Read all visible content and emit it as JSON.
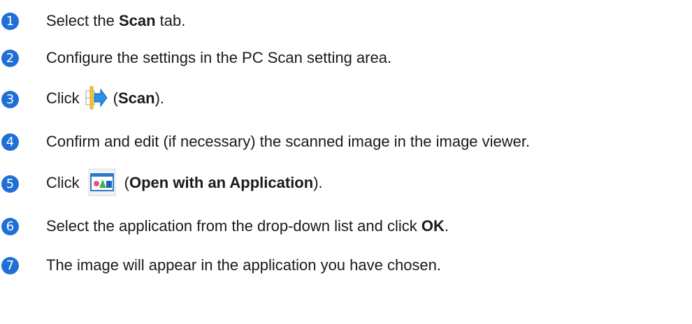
{
  "steps": [
    {
      "num": "1",
      "pre": "Select the ",
      "bold": "Scan",
      "post": " tab."
    },
    {
      "num": "2",
      "text": "Configure the settings in the PC Scan setting area."
    },
    {
      "num": "3",
      "pre": "Click",
      "icon": "scan-icon",
      "paren_open": "(",
      "bold": "Scan",
      "paren_close": ")."
    },
    {
      "num": "4",
      "text": "Confirm and edit (if necessary) the scanned image in the image viewer."
    },
    {
      "num": "5",
      "pre": "Click",
      "icon": "open-with-application-icon",
      "paren_open": "(",
      "bold": "Open with an Application",
      "paren_close": ")."
    },
    {
      "num": "6",
      "pre": "Select the application from the drop-down list and click ",
      "bold": "OK",
      "post": "."
    },
    {
      "num": "7",
      "text": "The image will appear in the application you have chosen."
    }
  ],
  "colors": {
    "step_badge": "#1f6fd6",
    "text": "#1a1a1a"
  }
}
